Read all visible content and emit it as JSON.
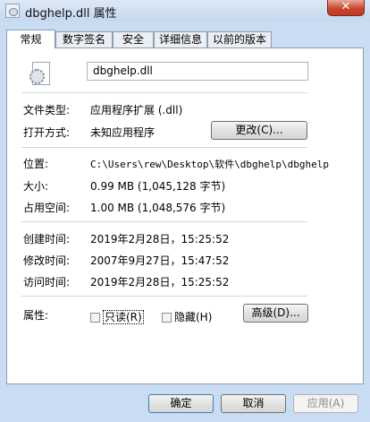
{
  "window": {
    "title": "dbghelp.dll 属性",
    "close_label": "✕"
  },
  "tabs": [
    "常规",
    "数字签名",
    "安全",
    "详细信息",
    "以前的版本"
  ],
  "general": {
    "file_name": "dbghelp.dll",
    "file_type_label": "文件类型:",
    "file_type_value": "应用程序扩展 (.dll)",
    "opens_with_label": "打开方式:",
    "opens_with_value": "未知应用程序",
    "change_button": "更改(C)...",
    "location_label": "位置:",
    "location_value": "C:\\Users\\rew\\Desktop\\软件\\dbghelp\\dbghelp",
    "size_label": "大小:",
    "size_value": "0.99 MB (1,045,128 字节)",
    "size_on_disk_label": "占用空间:",
    "size_on_disk_value": "1.00 MB (1,048,576 字节)",
    "created_label": "创建时间:",
    "created_value": "2019年2月28日，15:25:52",
    "modified_label": "修改时间:",
    "modified_value": "2007年9月27日，15:47:52",
    "accessed_label": "访问时间:",
    "accessed_value": "2019年2月28日，15:25:52",
    "attributes_label": "属性:",
    "readonly_label": "只读(R)",
    "hidden_label": "隐藏(H)",
    "advanced_button": "高级(D)..."
  },
  "footer": {
    "ok": "确定",
    "cancel": "取消",
    "apply": "应用(A)"
  }
}
